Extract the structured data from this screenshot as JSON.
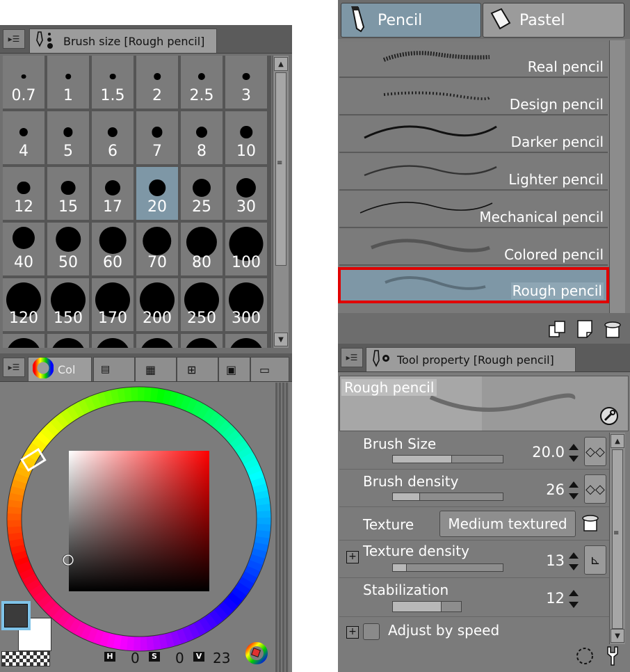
{
  "brush_size_panel": {
    "tab_title": "Brush size [Rough pencil]",
    "sizes": [
      "0.7",
      "1",
      "1.5",
      "2",
      "2.5",
      "3",
      "4",
      "5",
      "6",
      "7",
      "8",
      "10",
      "12",
      "15",
      "17",
      "20",
      "25",
      "30",
      "40",
      "50",
      "60",
      "70",
      "80",
      "100",
      "120",
      "150",
      "170",
      "200",
      "250",
      "300"
    ],
    "selected": "20"
  },
  "color_panel": {
    "tab_label": "Col",
    "h_label": "H",
    "h_value": "0",
    "s_label": "S",
    "s_value": "0",
    "v_label": "V",
    "v_value": "23",
    "colors": {
      "main": "#3b3b3b",
      "sub": "#ffffff",
      "hue": "#ff0000"
    }
  },
  "tool_tabs": [
    {
      "label": "Pencil",
      "icon": "pencil-icon",
      "active": true
    },
    {
      "label": "Pastel",
      "icon": "pastel-icon",
      "active": false
    }
  ],
  "sub_tools": [
    {
      "label": "Real pencil"
    },
    {
      "label": "Design pencil"
    },
    {
      "label": "Darker pencil"
    },
    {
      "label": "Lighter pencil"
    },
    {
      "label": "Mechanical pencil"
    },
    {
      "label": "Colored pencil"
    },
    {
      "label": "Rough pencil",
      "selected": true
    }
  ],
  "tool_property": {
    "tab_title": "Tool property [Rough pencil]",
    "preview_name": "Rough pencil",
    "brush_size": {
      "label": "Brush Size",
      "value": "20.0",
      "fill": 0.53
    },
    "brush_density": {
      "label": "Brush density",
      "value": "26",
      "fill": 0.24
    },
    "texture": {
      "label": "Texture",
      "value": "Medium textured"
    },
    "texture_density": {
      "label": "Texture density",
      "value": "13",
      "fill": 0.12
    },
    "stabilization": {
      "label": "Stabilization",
      "value": "12",
      "fill": 0.7
    },
    "adjust_by_speed": {
      "label": "Adjust by speed",
      "checked": false
    }
  },
  "accent": {
    "selection_outline": "#e00000",
    "selected_bg": "#7e97a6"
  }
}
